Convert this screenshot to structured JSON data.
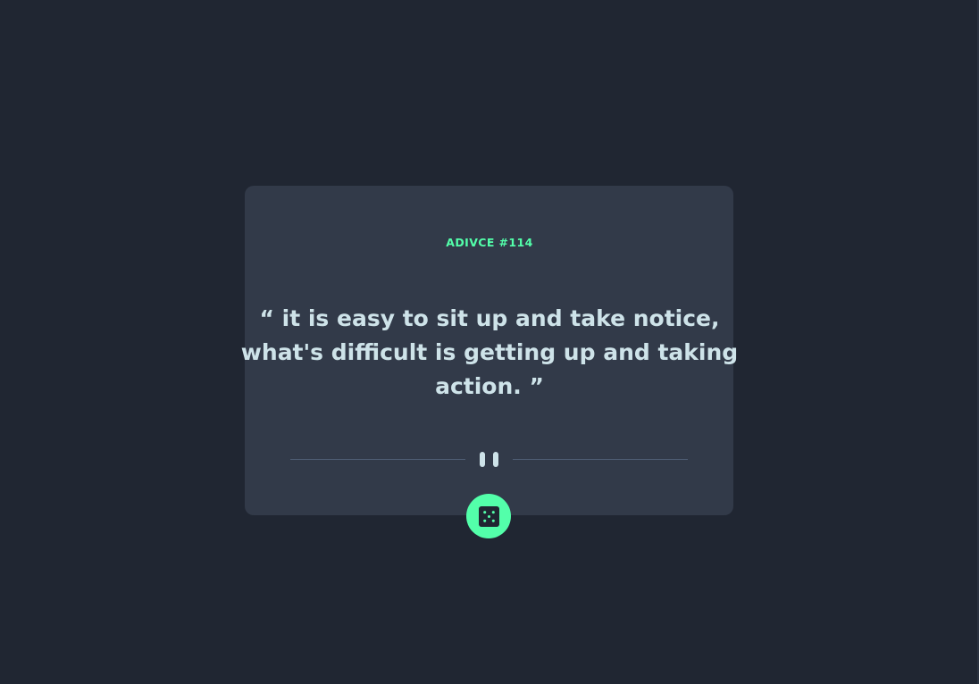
{
  "advice": {
    "label": "ADIVCE #114",
    "quote": "“ it is easy to sit up and take notice, what's difficult is getting up and taking action. ”"
  },
  "icons": {
    "divider_center": "pause-icon",
    "button": "dice-icon"
  },
  "colors": {
    "background": "#202632",
    "card": "#323a49",
    "accent": "#53ffaa",
    "quote_text": "#cee3e9",
    "divider": "#4f5d74"
  }
}
